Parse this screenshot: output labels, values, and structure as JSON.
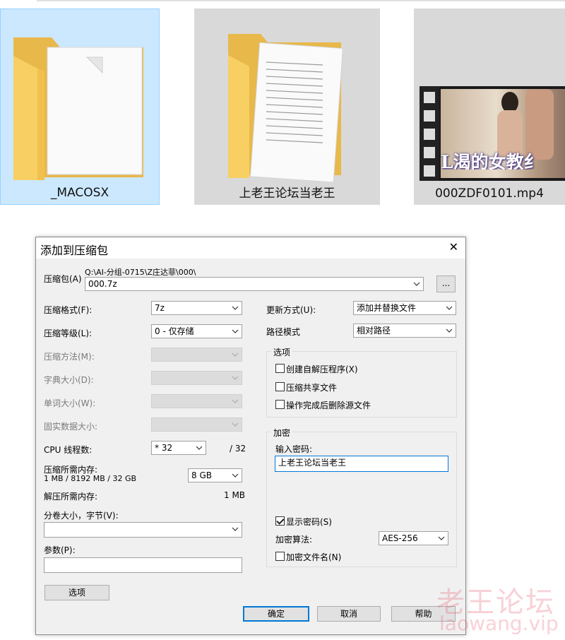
{
  "explorer": {
    "tiles": [
      {
        "label": "_MACOSX",
        "selected": true
      },
      {
        "label": "上老王论坛当老王",
        "selected": false
      },
      {
        "label": "000ZDF0101.mp4",
        "selected": false
      }
    ],
    "video_thumb_caption": "L渴的女教纟"
  },
  "dialog": {
    "title": "添加到压缩包",
    "archive_label": "压缩包(A)",
    "archive_path": "Q:\\AI-分组-0715\\Z庄达菲\\000\\",
    "archive_name": "000.7z",
    "browse_label": "...",
    "left": {
      "format_label": "压缩格式(F):",
      "format_value": "7z",
      "level_label": "压缩等级(L):",
      "level_value": "0 - 仅存储",
      "method_label": "压缩方法(M):",
      "dict_label": "字典大小(D):",
      "word_label": "单词大小(W):",
      "solid_label": "固实数据大小:",
      "cpu_label": "CPU 线程数:",
      "cpu_value": "* 32",
      "cpu_total": "/ 32",
      "mem_label": "压缩所需内存:",
      "mem_detail": "1 MB / 8192 MB / 32 GB",
      "mem_value": "8 GB",
      "decomp_label": "解压所需内存:",
      "decomp_value": "1 MB",
      "volume_label": "分卷大小，字节(V):",
      "params_label": "参数(P):",
      "options_button": "选项"
    },
    "right": {
      "update_label": "更新方式(U):",
      "update_value": "添加并替换文件",
      "path_label": "路径模式",
      "path_value": "相对路径",
      "options_group": "选项",
      "sfx_label": "创建自解压程序(X)",
      "shared_label": "压缩共享文件",
      "delete_label": "操作完成后删除源文件",
      "encrypt_group": "加密",
      "password_label": "输入密码:",
      "password_value": "上老王论坛当老王",
      "show_password_label": "显示密码(S)",
      "enc_method_label": "加密算法:",
      "enc_method_value": "AES-256",
      "enc_names_label": "加密文件名(N)"
    },
    "buttons": {
      "ok": "确定",
      "cancel": "取消",
      "help": "帮助"
    }
  },
  "watermark": {
    "cn": "老王论坛",
    "url": "laowang.vip"
  },
  "colors": {
    "selection": "#cce8ff",
    "folder": "#f5c95a",
    "accent": "#0078d7"
  }
}
